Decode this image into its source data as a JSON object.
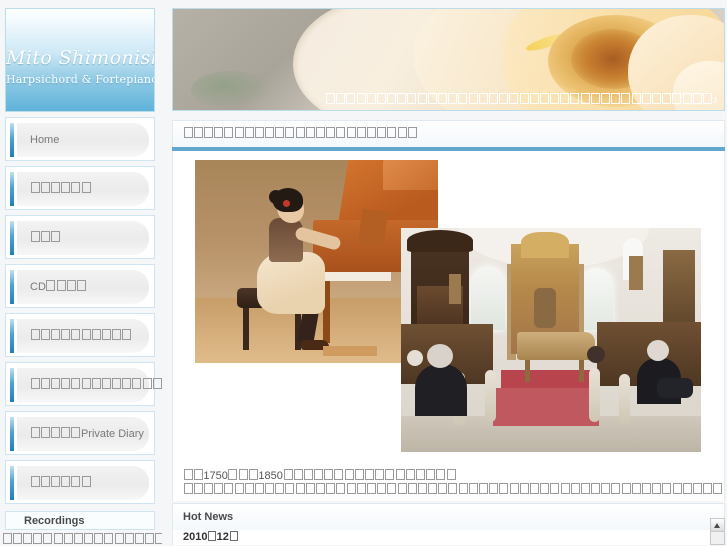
{
  "site": {
    "logo_title": "Mito Shimonishi",
    "logo_subtitle": "Harpsichord & Fortepiano"
  },
  "sidebar": {
    "items": [
      {
        "label": "Home",
        "tofu": 0
      },
      {
        "label": "",
        "tofu": 6
      },
      {
        "label": "",
        "tofu": 3
      },
      {
        "label": "CD",
        "tofu": 4,
        "text_first": true
      },
      {
        "label": "",
        "tofu": 10
      },
      {
        "label": "",
        "tofu": 13
      },
      {
        "label": "Private Diary",
        "tofu": 5,
        "text_first": false
      },
      {
        "label": "",
        "tofu": 6
      }
    ],
    "recordings_heading": "Recordings",
    "recordings_text_tofu": 28
  },
  "banner": {
    "overlay_tofu": 38,
    "overlay_note": "♪"
  },
  "main": {
    "section_title_tofu": 23,
    "caption_line1_prefix_tofu": 2,
    "caption_line1_year1": "1750",
    "caption_line1_mid_tofu": 3,
    "caption_line1_year2": "1850",
    "caption_line1_suffix_tofu": 17,
    "caption_line2_tofu": 54
  },
  "news": {
    "section_title": "Hot News",
    "item_year": "2010",
    "item_month": "12",
    "scrollbar_up_icon": "scroll-up-arrow-icon"
  },
  "colors": {
    "accent_blue": "#62a8cc",
    "border_blue": "#bcdcea",
    "panel_white": "#ffffff",
    "page_bg": "#f4f6f7"
  }
}
